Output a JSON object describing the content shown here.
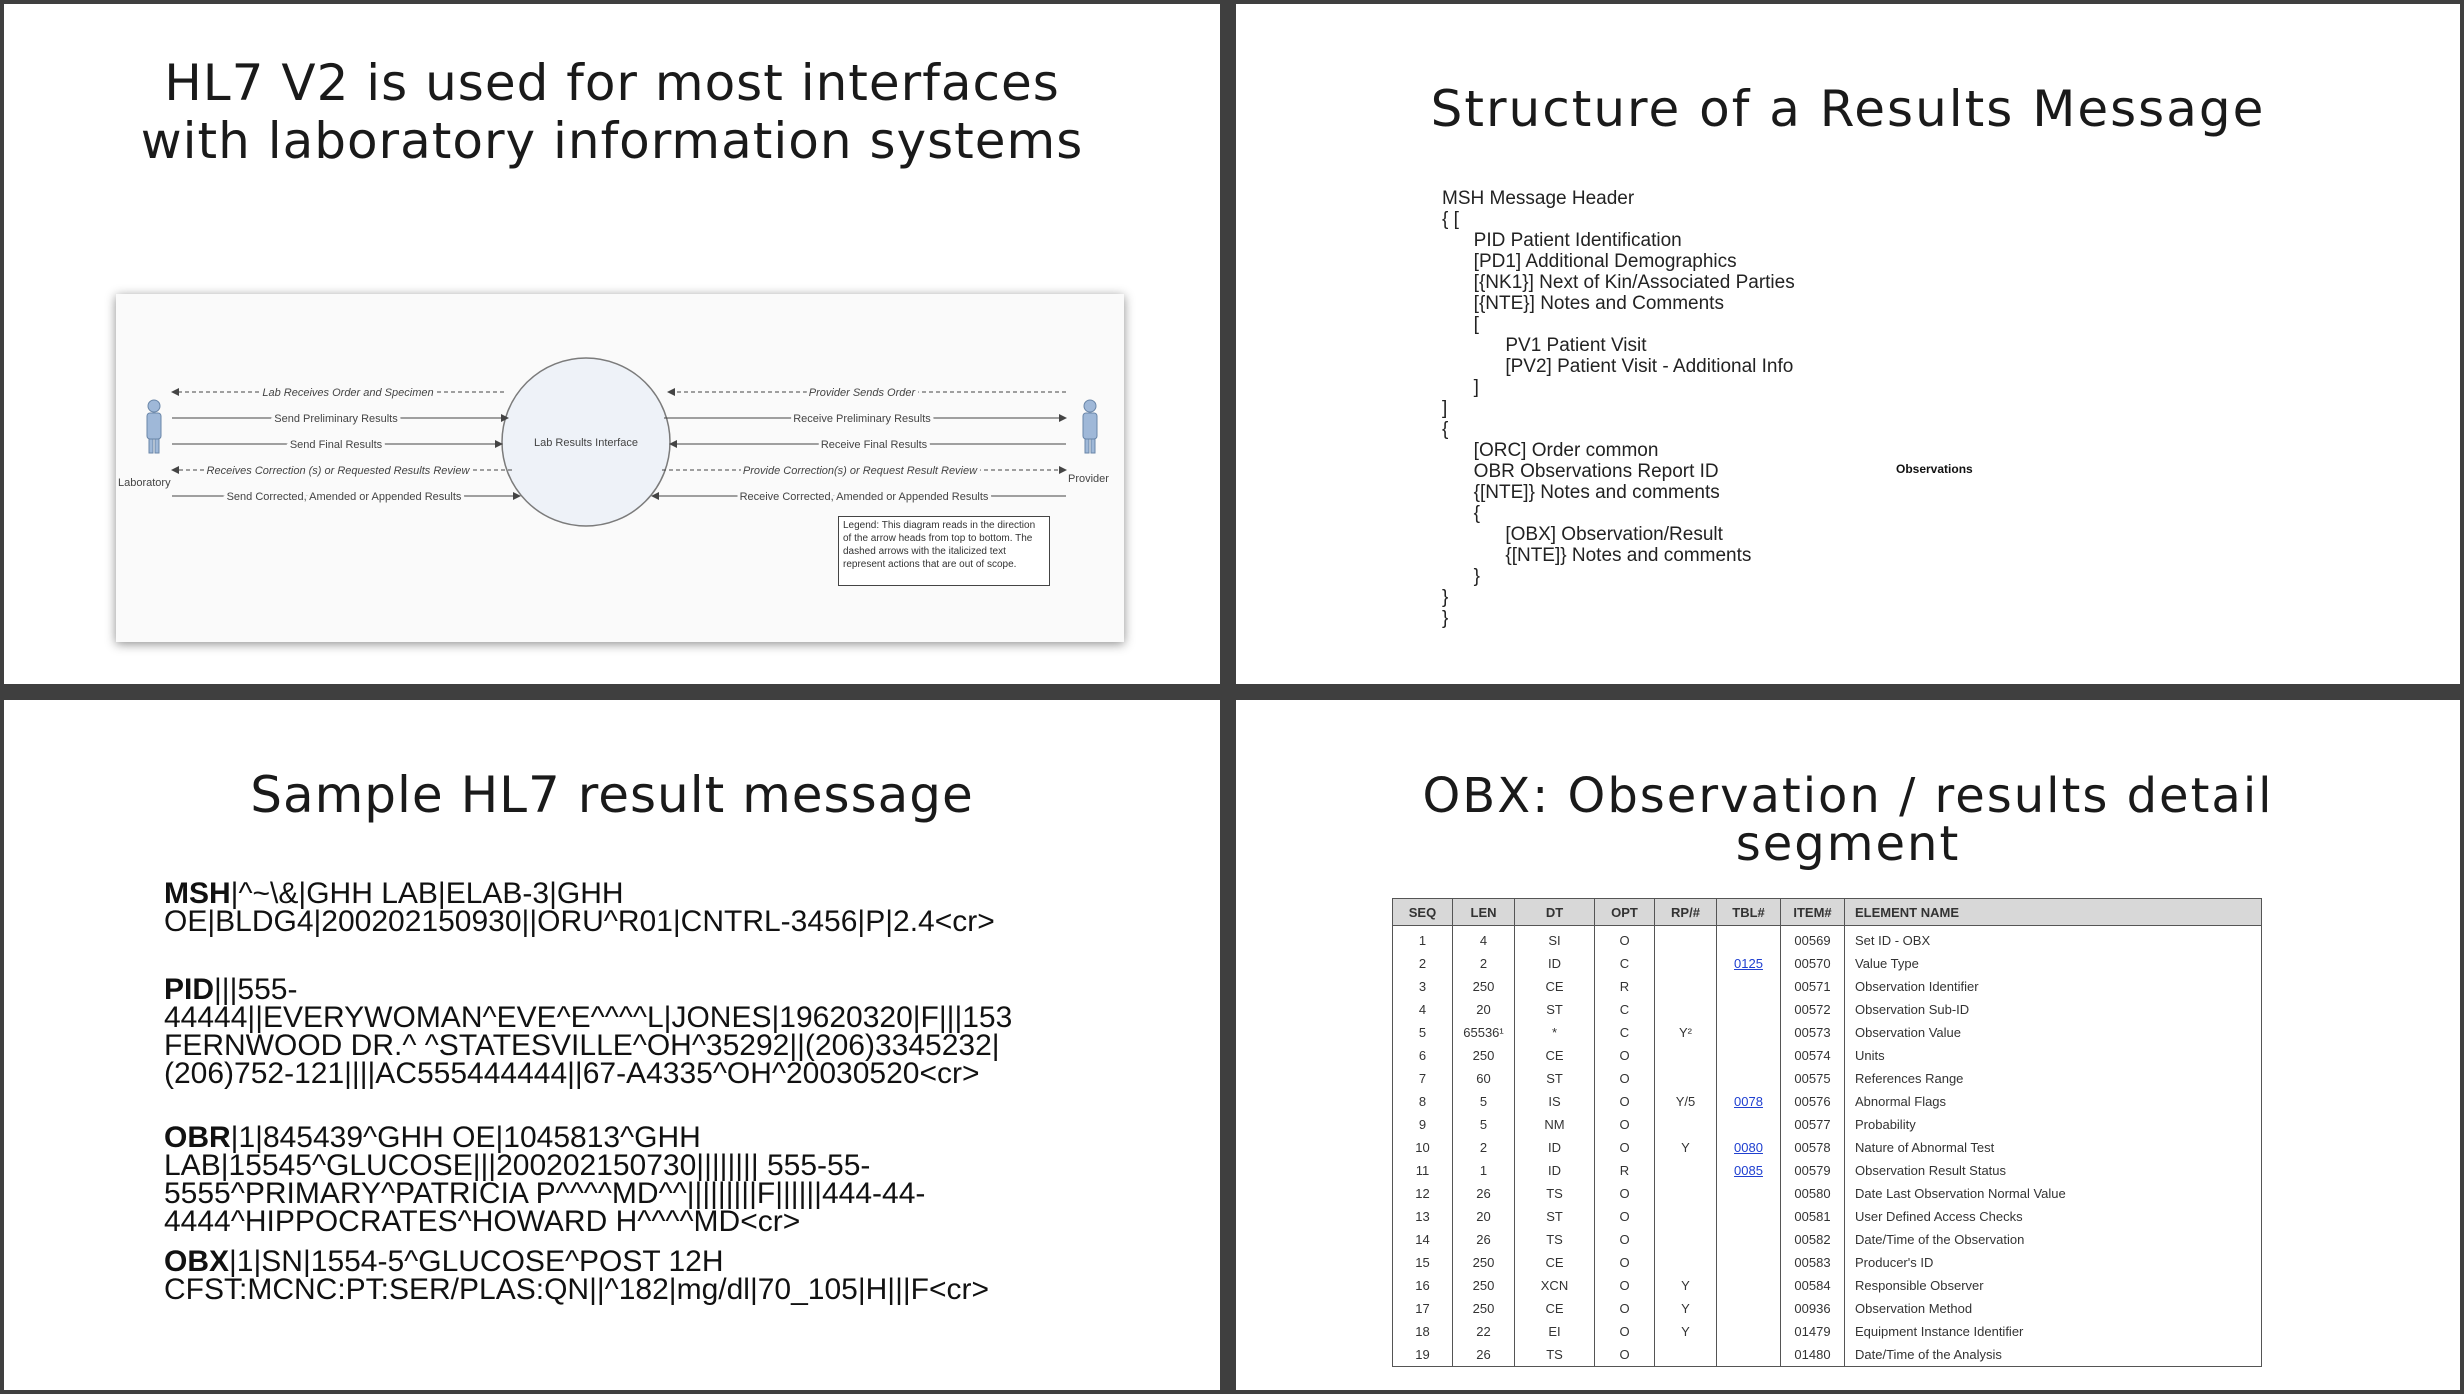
{
  "slide1": {
    "title_line1": "HL7 V2 is used for most interfaces",
    "title_line2": "with laboratory information systems",
    "diagram": {
      "center_label": "Lab Results Interface",
      "left_actor": "Laboratory",
      "right_actor": "Provider",
      "left_arrows": [
        "Lab Receives Order and Specimen",
        "Send Preliminary Results",
        "Send Final Results",
        "Receives Correction (s) or Requested Results Review",
        "Send Corrected, Amended or Appended Results"
      ],
      "right_arrows": [
        "Provider Sends Order",
        "Receive Preliminary Results",
        "Receive Final Results",
        "Provide Correction(s) or Request Result Review",
        "Receive Corrected, Amended or Appended Results"
      ],
      "legend": "Legend:  This diagram reads in the direction of the arrow heads from top to bottom.  The dashed arrows with the italicized text represent actions that are out of scope."
    }
  },
  "slide2": {
    "title": "Structure of a Results Message",
    "lines": [
      "MSH Message Header",
      "{ [",
      "      PID Patient Identification",
      "      [PD1] Additional Demographics",
      "      [{NK1}] Next of Kin/Associated Parties",
      "      [{NTE}] Notes and Comments",
      "      [",
      "            PV1 Patient Visit",
      "            [PV2] Patient Visit - Additional Info",
      "      ]",
      "]",
      "{",
      "      [ORC] Order common",
      "      OBR Observations Report ID",
      "      {[NTE]} Notes and comments",
      "      {",
      "            [OBX] Observation/Result",
      "            {[NTE]} Notes and comments",
      "      }",
      "}",
      "}"
    ],
    "side_label": "Observations"
  },
  "slide3": {
    "title": "Sample HL7 result message",
    "segments": [
      {
        "id": "MSH",
        "text": "|^~\\&|GHH LAB|ELAB-3|GHH OE|BLDG4|200202150930||ORU^R01|CNTRL-3456|P|2.4<cr>"
      },
      {
        "id": " PID",
        "text": "|||555-44444||EVERYWOMAN^EVE^E^^^^L|JONES|19620320|F|||153 FERNWOOD DR.^ ^STATESVILLE^OH^35292||(206)3345232|(206)752-121||||AC555444444||67-A4335^OH^20030520<cr>"
      },
      {
        "id": "OBR",
        "text": "|1|845439^GHH OE|1045813^GHH LAB|15545^GLUCOSE|||200202150730|||||||| 555-55-5555^PRIMARY^PATRICIA P^^^^MD^^|||||||||F||||||444-44-4444^HIPPOCRATES^HOWARD H^^^^MD<cr>"
      },
      {
        "id": "OBX",
        "text": "|1|SN|1554-5^GLUCOSE^POST 12H CFST:MCNC:PT:SER/PLAS:QN||^182|mg/dl|70_105|H|||F<cr>"
      }
    ]
  },
  "slide4": {
    "title": "OBX: Observation / results detail segment",
    "headers": [
      "SEQ",
      "LEN",
      "DT",
      "OPT",
      "RP/#",
      "TBL#",
      "ITEM#",
      "ELEMENT NAME"
    ],
    "rows": [
      [
        "1",
        "4",
        "SI",
        "O",
        "",
        "",
        "00569",
        "Set ID - OBX"
      ],
      [
        "2",
        "2",
        "ID",
        "C",
        "",
        "0125",
        "00570",
        "Value Type"
      ],
      [
        "3",
        "250",
        "CE",
        "R",
        "",
        "",
        "00571",
        "Observation Identifier"
      ],
      [
        "4",
        "20",
        "ST",
        "C",
        "",
        "",
        "00572",
        "Observation Sub-ID"
      ],
      [
        "5",
        "65536¹",
        "*",
        "C",
        "Y²",
        "",
        "00573",
        "Observation Value"
      ],
      [
        "6",
        "250",
        "CE",
        "O",
        "",
        "",
        "00574",
        "Units"
      ],
      [
        "7",
        "60",
        "ST",
        "O",
        "",
        "",
        "00575",
        "References Range"
      ],
      [
        "8",
        "5",
        "IS",
        "O",
        "Y/5",
        "0078",
        "00576",
        "Abnormal Flags"
      ],
      [
        "9",
        "5",
        "NM",
        "O",
        "",
        "",
        "00577",
        "Probability"
      ],
      [
        "10",
        "2",
        "ID",
        "O",
        "Y",
        "0080",
        "00578",
        "Nature of Abnormal Test"
      ],
      [
        "11",
        "1",
        "ID",
        "R",
        "",
        "0085",
        "00579",
        "Observation Result Status"
      ],
      [
        "12",
        "26",
        "TS",
        "O",
        "",
        "",
        "00580",
        "Date Last Observation Normal Value"
      ],
      [
        "13",
        "20",
        "ST",
        "O",
        "",
        "",
        "00581",
        "User Defined Access Checks"
      ],
      [
        "14",
        "26",
        "TS",
        "O",
        "",
        "",
        "00582",
        "Date/Time of the Observation"
      ],
      [
        "15",
        "250",
        "CE",
        "O",
        "",
        "",
        "00583",
        "Producer's ID"
      ],
      [
        "16",
        "250",
        "XCN",
        "O",
        "Y",
        "",
        "00584",
        "Responsible Observer"
      ],
      [
        "17",
        "250",
        "CE",
        "O",
        "Y",
        "",
        "00936",
        "Observation Method"
      ],
      [
        "18",
        "22",
        "EI",
        "O",
        "Y",
        "",
        "01479",
        "Equipment Instance Identifier"
      ],
      [
        "19",
        "26",
        "TS",
        "O",
        "",
        "",
        "01480",
        "Date/Time of the Analysis"
      ]
    ]
  }
}
